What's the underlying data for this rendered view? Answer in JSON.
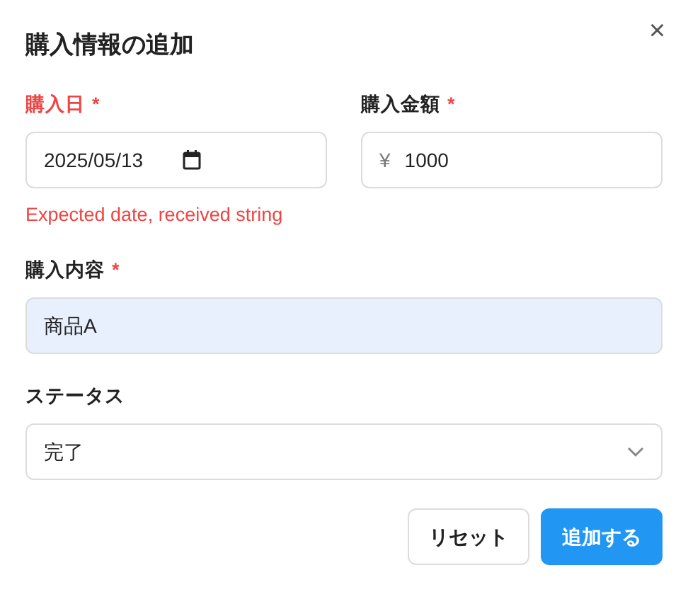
{
  "dialog": {
    "title": "購入情報の追加",
    "close": "×"
  },
  "fields": [
    {
      "kind": "date",
      "label": "購入日",
      "required_mark": "*",
      "invalid": true,
      "value": "2025/05/13",
      "error": "Expected date, received string"
    },
    {
      "kind": "currency",
      "label": "購入金額",
      "required_mark": "*",
      "invalid": false,
      "prefix": "¥",
      "value": "1000"
    },
    {
      "kind": "text",
      "label": "購入内容",
      "required_mark": "*",
      "invalid": false,
      "autofilled": true,
      "value": "商品A"
    },
    {
      "kind": "select",
      "label": "ステータス",
      "invalid": false,
      "value": "完了"
    }
  ],
  "buttons": [
    {
      "label": "リセット",
      "kind": "secondary"
    },
    {
      "label": "追加する",
      "kind": "primary"
    }
  ]
}
